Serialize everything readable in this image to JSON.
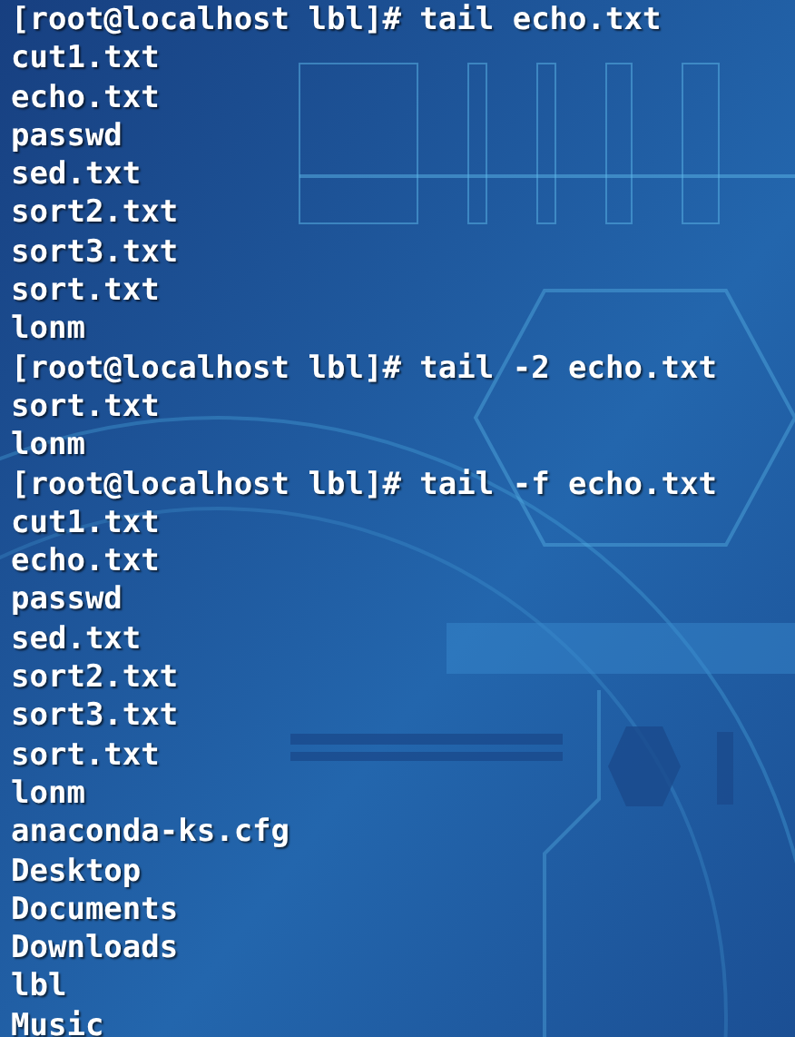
{
  "terminal": {
    "lines": [
      "[root@localhost lbl]# tail echo.txt",
      "cut1.txt",
      "echo.txt",
      "passwd",
      "sed.txt",
      "sort2.txt",
      "sort3.txt",
      "sort.txt",
      "lonm",
      "[root@localhost lbl]# tail -2 echo.txt",
      "sort.txt",
      "lonm",
      "[root@localhost lbl]# tail -f echo.txt",
      "cut1.txt",
      "echo.txt",
      "passwd",
      "sed.txt",
      "sort2.txt",
      "sort3.txt",
      "sort.txt",
      "lonm",
      "anaconda-ks.cfg",
      "Desktop",
      "Documents",
      "Downloads",
      "lbl",
      "Music"
    ]
  }
}
